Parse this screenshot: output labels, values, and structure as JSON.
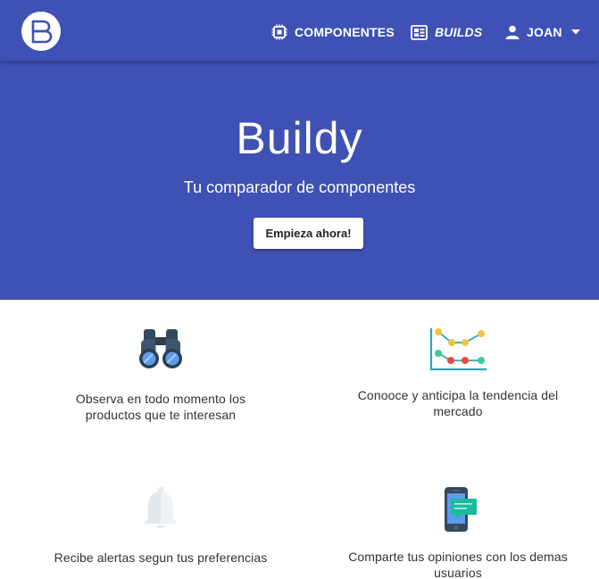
{
  "nav": {
    "logo_icon": "buildy-logo-icon",
    "items": [
      {
        "label": "COMPONENTES",
        "icon": "chip-icon",
        "italic": false
      },
      {
        "label": "BUILDS",
        "icon": "builds-icon",
        "italic": true
      },
      {
        "label": "JOAN",
        "icon": "user-icon",
        "italic": false
      }
    ]
  },
  "hero": {
    "title": "Buildy",
    "subtitle": "Tu comparador de componentes",
    "cta_label": "Empieza ahora!"
  },
  "features": [
    {
      "icon": "binoculars-icon",
      "line1": "Observa en todo momento los",
      "line2": "productos que te interesan"
    },
    {
      "icon": "trend-chart-icon",
      "line1": "Conooce y anticipa la tendencia del",
      "line2": "mercado"
    },
    {
      "icon": "bell-icon",
      "line1": "Recibe alertas segun tus preferencias",
      "line2": ""
    },
    {
      "icon": "phone-chat-icon",
      "line1": "Comparte tus opiniones con los demas",
      "line2": "usuarios"
    }
  ],
  "colors": {
    "primary": "#3f51b5",
    "background": "#ffffff",
    "text": "#333333"
  }
}
